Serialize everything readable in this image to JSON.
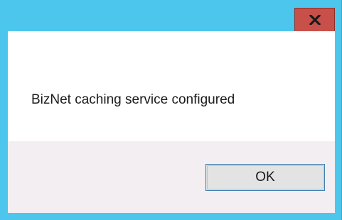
{
  "dialog": {
    "message": "BizNet caching service configured",
    "ok_label": "OK",
    "close_icon": "close-icon",
    "colors": {
      "frame": "#4cc6ec",
      "close_button": "#c7504a",
      "content_background": "#ffffff",
      "footer_background": "#f2eef2",
      "ok_button_border": "#3c7fb1"
    }
  }
}
